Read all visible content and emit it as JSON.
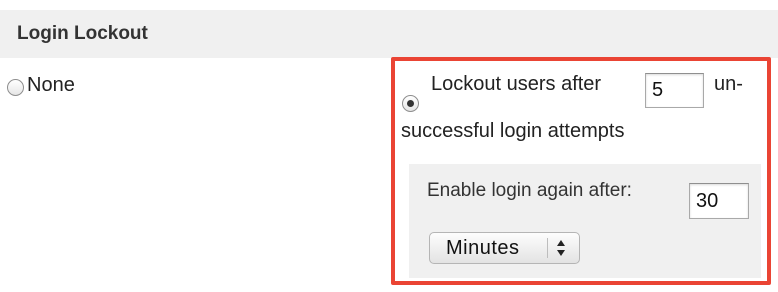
{
  "section": {
    "title": "Login Lockout"
  },
  "options": {
    "none_label": "None",
    "lockout_prefix": "Lockout users after",
    "lockout_suffix_line1": "un-",
    "lockout_suffix_line2": "successful login attempts"
  },
  "fields": {
    "attempts_value": "5",
    "enable_label": "Enable login again after:",
    "enable_value": "30",
    "unit_selected": "Minutes"
  },
  "colors": {
    "highlight_border": "#ea4434",
    "header_bg": "#f0f0f0"
  },
  "icons": {
    "select_arrows": "up-down-chevron-icon"
  }
}
